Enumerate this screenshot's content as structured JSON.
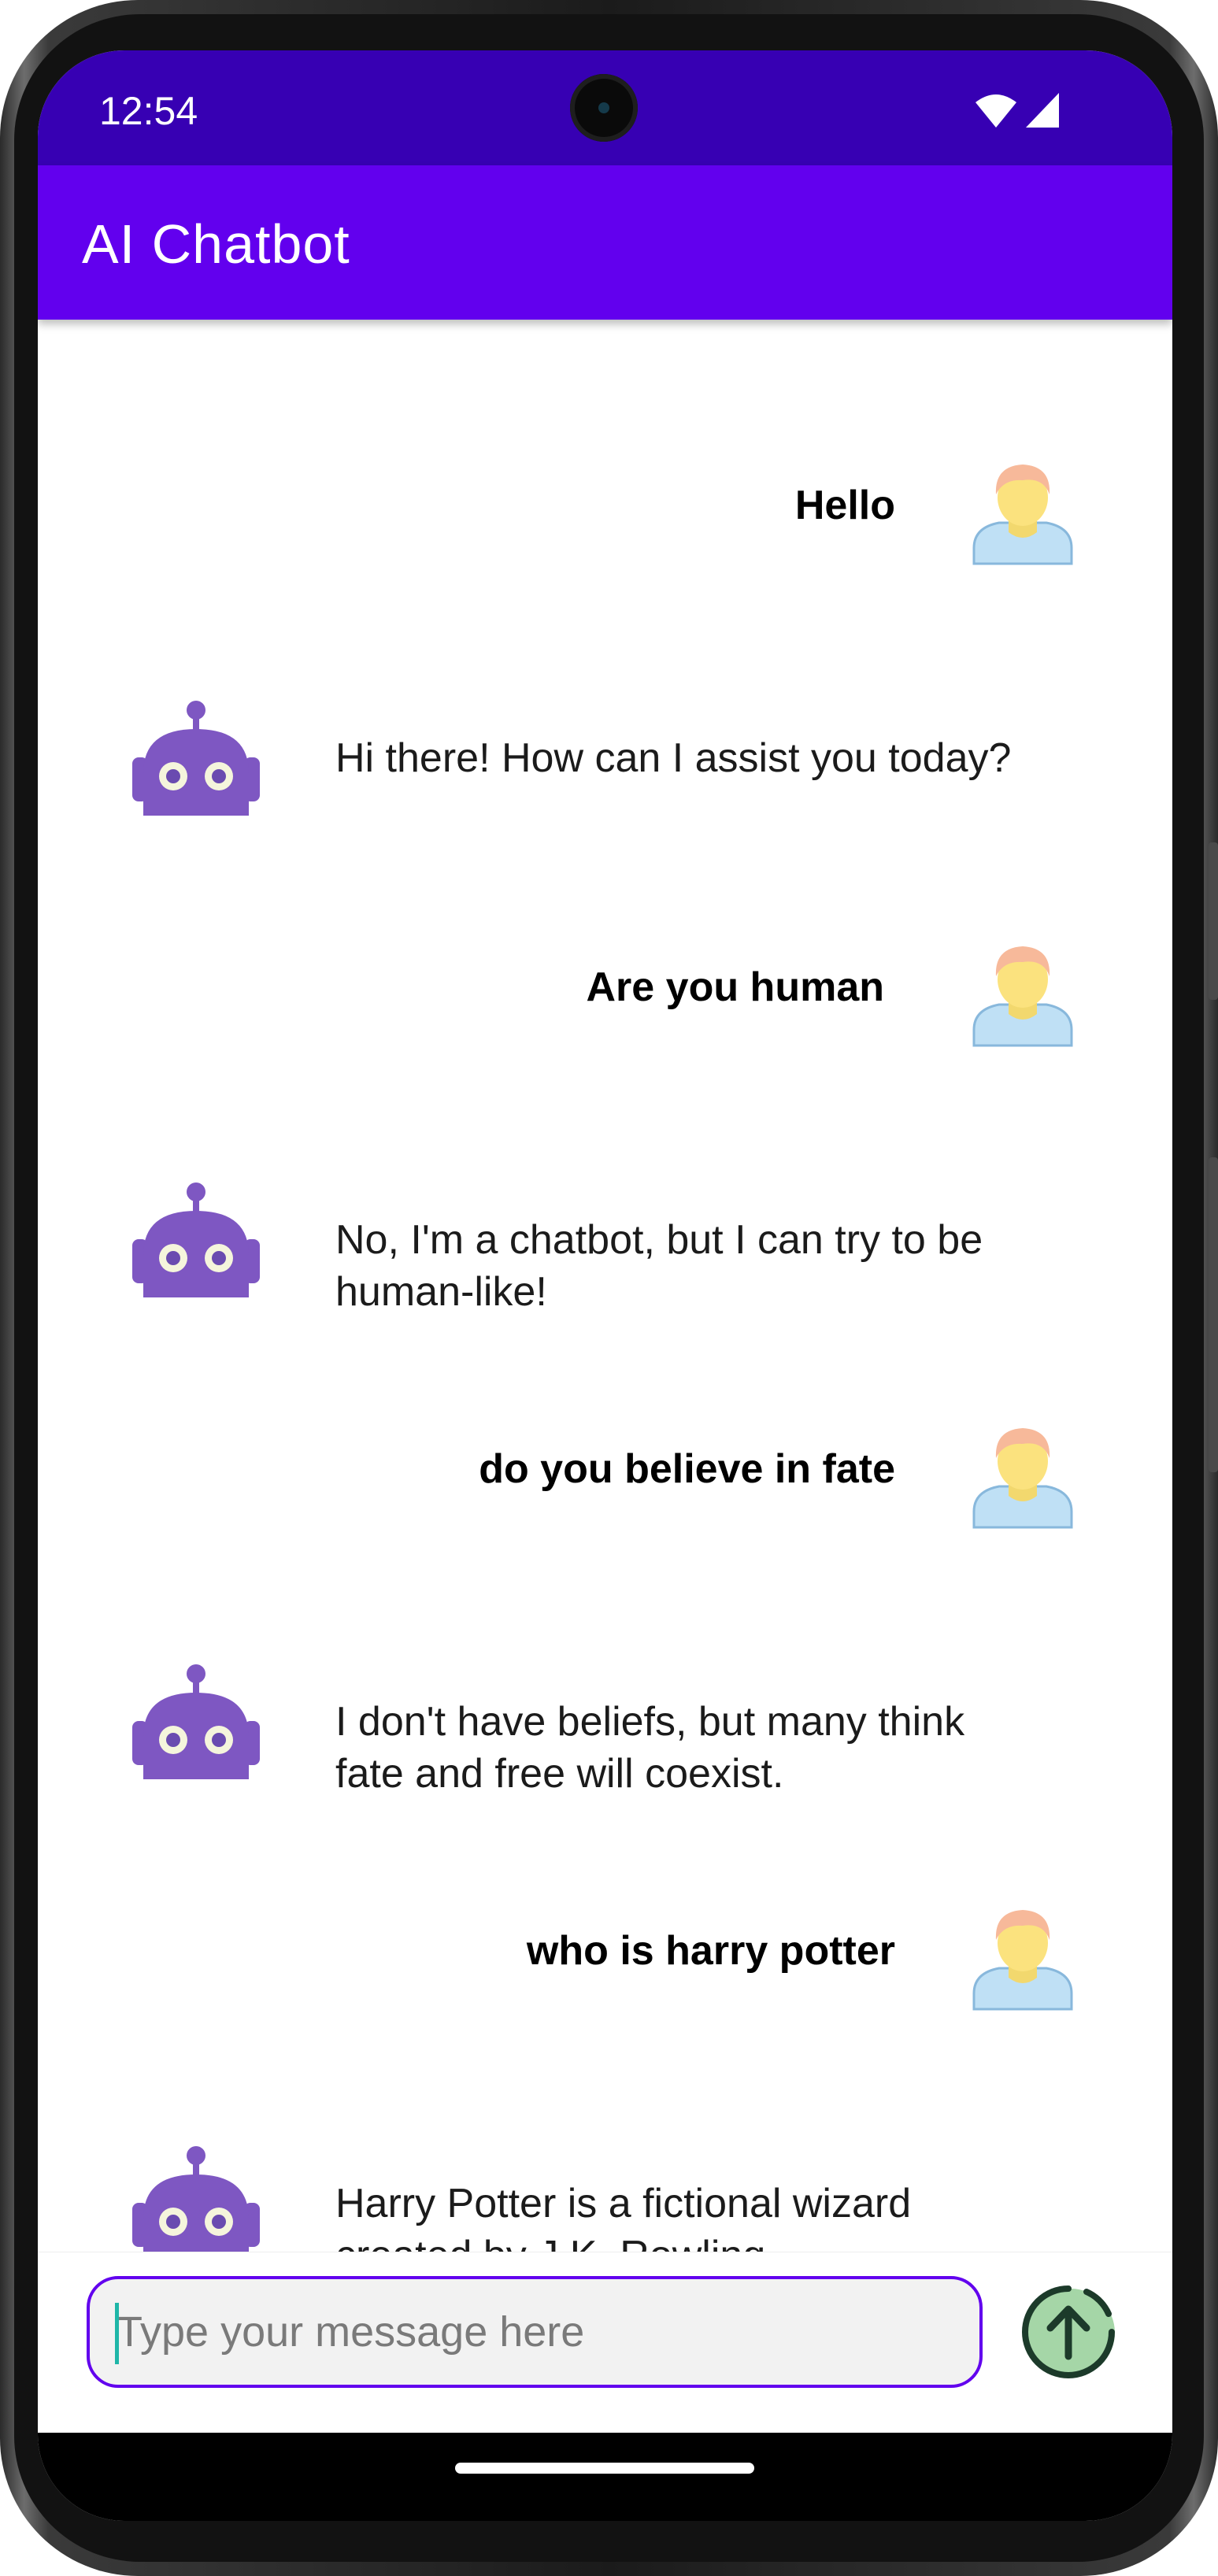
{
  "status_bar": {
    "time": "12:54",
    "icons": [
      "wifi-icon",
      "cell-signal-icon"
    ]
  },
  "app_bar": {
    "title": "AI Chatbot"
  },
  "messages": [
    {
      "sender": "user",
      "text": "Hello"
    },
    {
      "sender": "bot",
      "text": "Hi there! How can I assist you today?"
    },
    {
      "sender": "user",
      "text": "Are you human"
    },
    {
      "sender": "bot",
      "text": "No, I'm a chatbot, but I can try to be human-like!"
    },
    {
      "sender": "user",
      "text": "do you believe in fate"
    },
    {
      "sender": "bot",
      "text": "I don't have beliefs, but many think fate and free will coexist."
    },
    {
      "sender": "user",
      "text": "who is harry potter"
    },
    {
      "sender": "bot",
      "text": "Harry Potter is a fictional wizard created by J.K. Rowling."
    }
  ],
  "composer": {
    "placeholder": "Type your message here",
    "value": "",
    "send_icon": "arrow-up-send-icon"
  },
  "colors": {
    "status_bar": "#3700b3",
    "app_bar": "#6200ee",
    "input_border": "#6200ee",
    "bot_avatar": "#7e57c2",
    "send_button_fill": "#a5d6a7"
  }
}
